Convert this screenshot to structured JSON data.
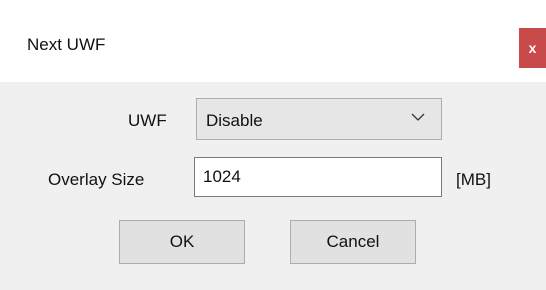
{
  "window": {
    "title": "Next UWF",
    "close_label": "x"
  },
  "form": {
    "uwf_label": "UWF",
    "uwf_selected": "Disable",
    "overlay_label": "Overlay Size",
    "overlay_value": "1024",
    "overlay_unit": "[MB]"
  },
  "buttons": {
    "ok_label": "OK",
    "cancel_label": "Cancel"
  },
  "colors": {
    "close_button_bg": "#c84a4a",
    "dialog_bg": "#f0f0f0",
    "titlebar_bg": "#ffffff"
  },
  "icons": {
    "dropdown": "chevron-down-icon",
    "close": "close-icon"
  }
}
